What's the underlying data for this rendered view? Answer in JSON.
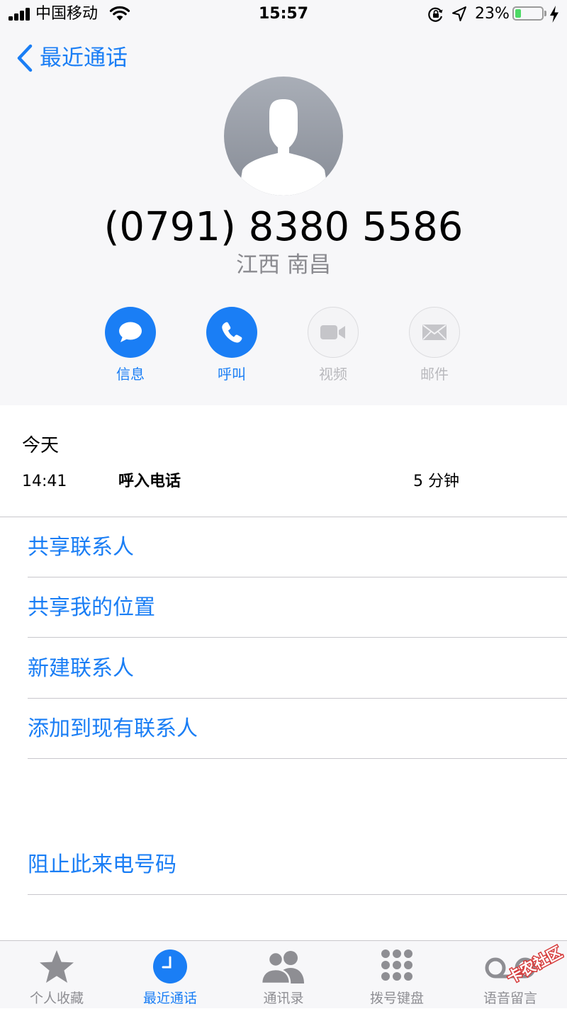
{
  "status_bar": {
    "carrier": "中国移动",
    "time": "15:57",
    "battery_percent": "23%",
    "battery_level": 0.23,
    "icons": [
      "signal-icon",
      "wifi-icon",
      "rotation-lock-icon",
      "location-arrow-icon",
      "battery-icon",
      "charging-bolt-icon"
    ]
  },
  "nav": {
    "back_label": "最近通话"
  },
  "contact": {
    "number": "(0791) 8380 5586",
    "location": "江西 南昌"
  },
  "actions": [
    {
      "label": "信息",
      "icon": "message-icon",
      "enabled": true
    },
    {
      "label": "呼叫",
      "icon": "phone-icon",
      "enabled": true
    },
    {
      "label": "视频",
      "icon": "video-icon",
      "enabled": false
    },
    {
      "label": "邮件",
      "icon": "mail-icon",
      "enabled": false
    }
  ],
  "recent": {
    "day": "今天",
    "calls": [
      {
        "time": "14:41",
        "type": "呼入电话",
        "duration": "5 分钟"
      }
    ]
  },
  "menu": [
    {
      "label": "共享联系人"
    },
    {
      "label": "共享我的位置"
    },
    {
      "label": "新建联系人"
    },
    {
      "label": "添加到现有联系人"
    }
  ],
  "block": {
    "label": "阻止此来电号码"
  },
  "tabbar": {
    "tabs": [
      {
        "label": "个人收藏",
        "icon": "star-icon",
        "active": false
      },
      {
        "label": "最近通话",
        "icon": "clock-icon",
        "active": true
      },
      {
        "label": "通讯录",
        "icon": "contacts-icon",
        "active": false
      },
      {
        "label": "拨号键盘",
        "icon": "keypad-icon",
        "active": false
      },
      {
        "label": "语音留言",
        "icon": "voicemail-icon",
        "active": false
      }
    ]
  },
  "watermark": {
    "text": "卡农社区"
  },
  "colors": {
    "accent": "#1a7ef5",
    "header_bg": "#f7f7f9",
    "separator": "#c8c7cc",
    "secondary_text": "#8a8a8f",
    "battery_fill": "#4cd964"
  }
}
